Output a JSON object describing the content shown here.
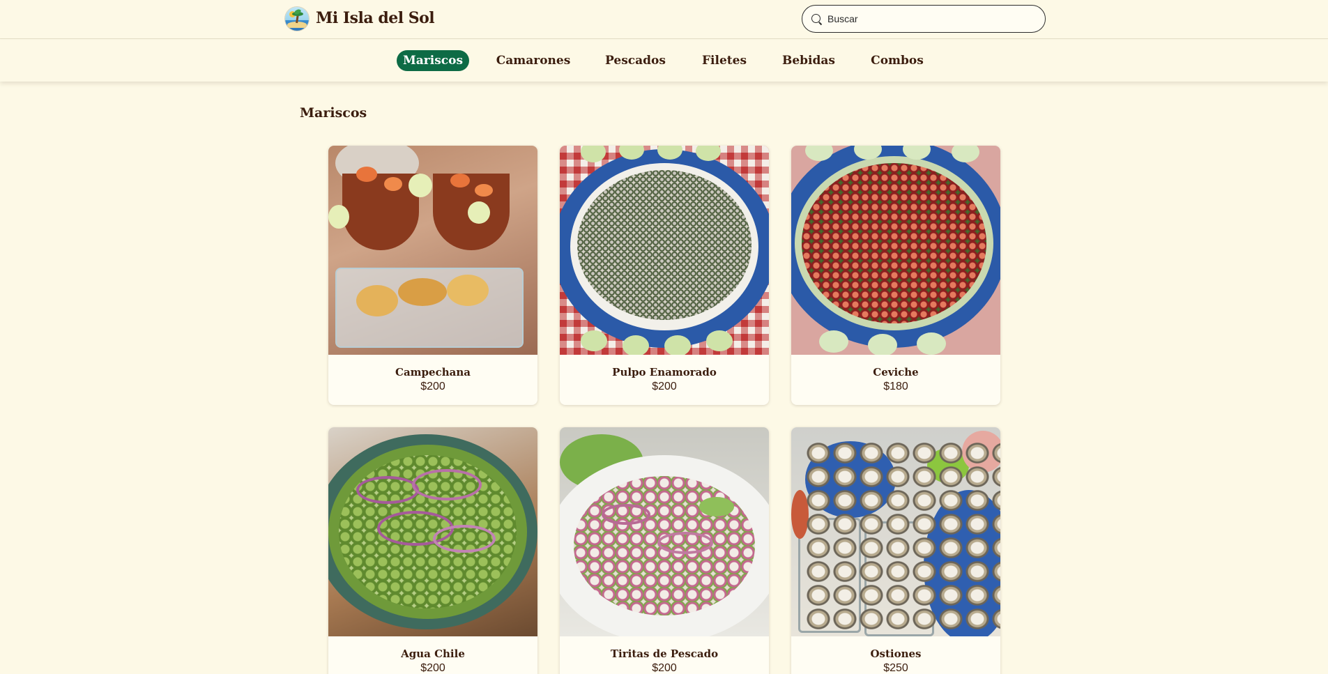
{
  "header": {
    "brand": "Mi Isla del Sol",
    "search_placeholder": "Buscar",
    "search_value": ""
  },
  "nav": {
    "tabs": [
      {
        "label": "Mariscos",
        "active": true
      },
      {
        "label": "Camarones",
        "active": false
      },
      {
        "label": "Pescados",
        "active": false
      },
      {
        "label": "Filetes",
        "active": false
      },
      {
        "label": "Bebidas",
        "active": false
      },
      {
        "label": "Combos",
        "active": false
      }
    ]
  },
  "section": {
    "title": "Mariscos",
    "items": [
      {
        "name": "Campechana",
        "price": "$200"
      },
      {
        "name": "Pulpo Enamorado",
        "price": "$200"
      },
      {
        "name": "Ceviche",
        "price": "$180"
      },
      {
        "name": "Agua Chile",
        "price": "$200"
      },
      {
        "name": "Tiritas de Pescado",
        "price": "$200"
      },
      {
        "name": "Ostiones",
        "price": "$250"
      }
    ]
  },
  "colors": {
    "background": "#fdf9e6",
    "accent": "#0d6b45",
    "text": "#3b1d0e"
  }
}
